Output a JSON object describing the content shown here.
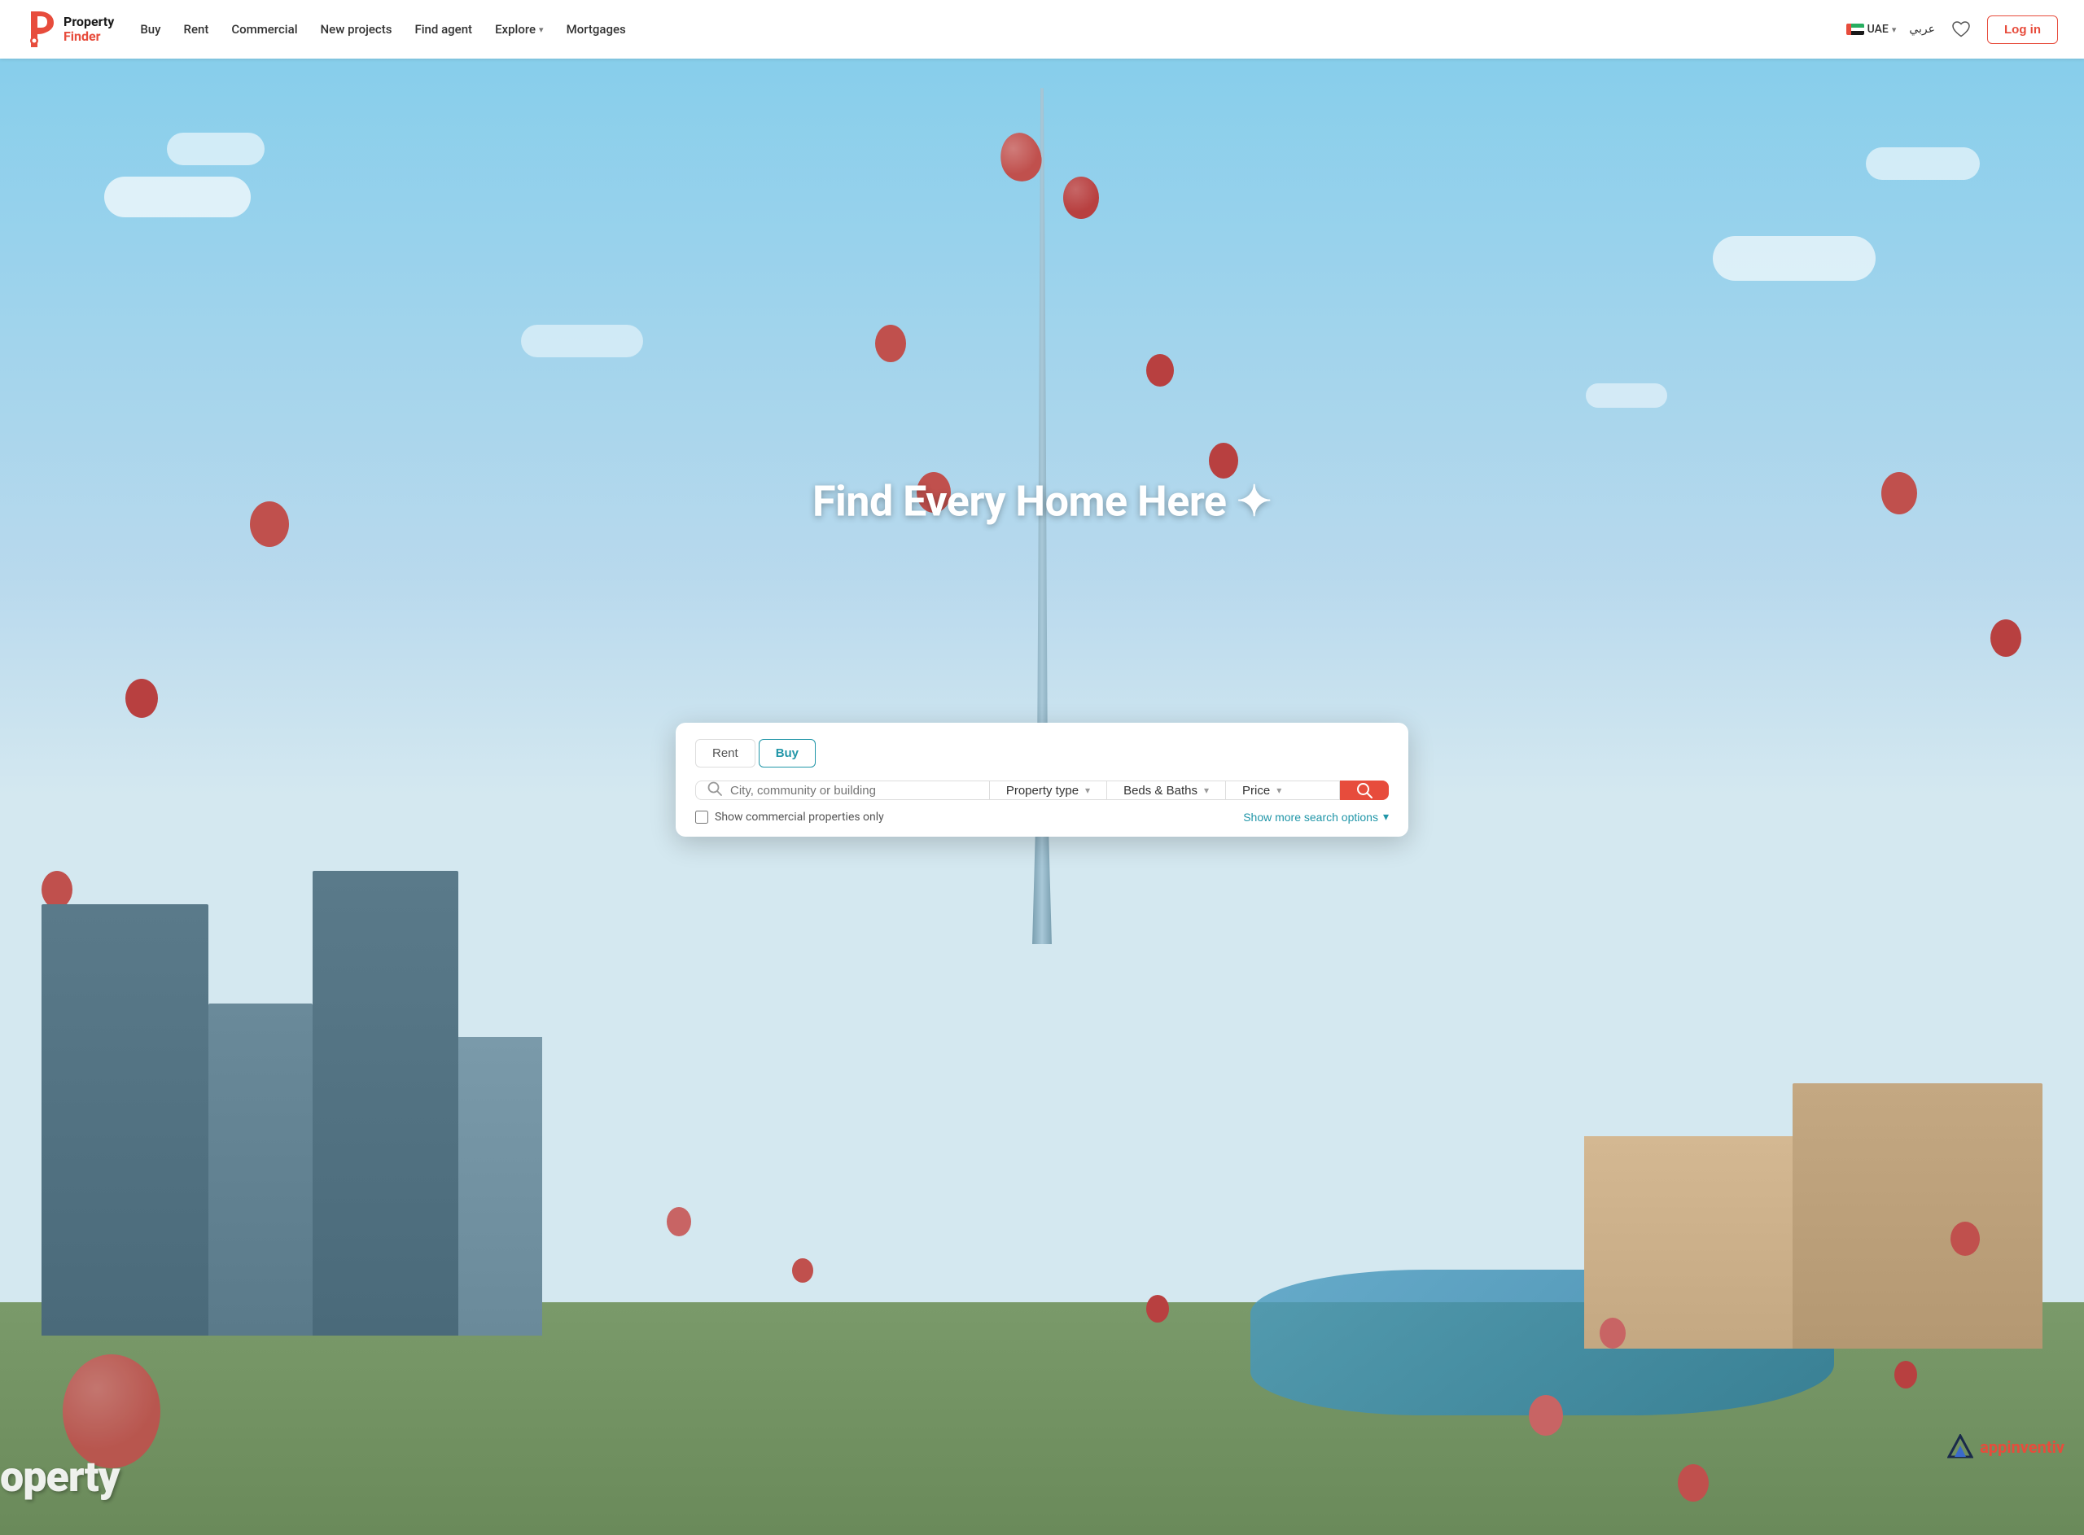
{
  "header": {
    "logo": {
      "property": "Property",
      "finder": "Finder"
    },
    "nav": {
      "buy": "Buy",
      "rent": "Rent",
      "commercial": "Commercial",
      "new_projects": "New projects",
      "find_agent": "Find agent",
      "explore": "Explore",
      "mortgages": "Mortgages"
    },
    "country": "UAE",
    "arabic": "عربي",
    "login": "Log in"
  },
  "hero": {
    "headline": "Find Every Home Here ✦",
    "tabs": [
      {
        "id": "rent",
        "label": "Rent",
        "active": false
      },
      {
        "id": "buy",
        "label": "Buy",
        "active": true
      }
    ],
    "search": {
      "placeholder": "City, community or building",
      "property_type_label": "Property type",
      "beds_baths_label": "Beds & Baths",
      "price_label": "Price",
      "search_button_label": "Search"
    },
    "commercial_checkbox": "Show commercial properties only",
    "show_more": "Show more search options"
  },
  "footer": {
    "appinventiv": "appinventiv"
  }
}
